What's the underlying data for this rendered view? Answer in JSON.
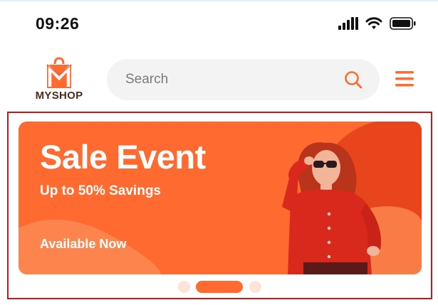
{
  "status_bar": {
    "time": "09:26",
    "icons": [
      "signal-icon",
      "wifi-icon",
      "battery-icon"
    ]
  },
  "header": {
    "logo_text": "MYSHOP",
    "search": {
      "placeholder": "Search",
      "icon": "search-icon"
    },
    "menu_icon": "hamburger-menu-icon"
  },
  "banner": {
    "title": "Sale Event",
    "subtitle": "Up to 50% Savings",
    "cta": "Available Now"
  },
  "carousel": {
    "slides": 3,
    "active_index": 1
  },
  "colors": {
    "accent": "#fe6a2f",
    "accent_dark": "#e8451c",
    "accent_light": "#fd8a52",
    "frame": "#c21a1a",
    "dot_inactive": "#fde3d8",
    "logo_dark": "#4a2b1c"
  }
}
